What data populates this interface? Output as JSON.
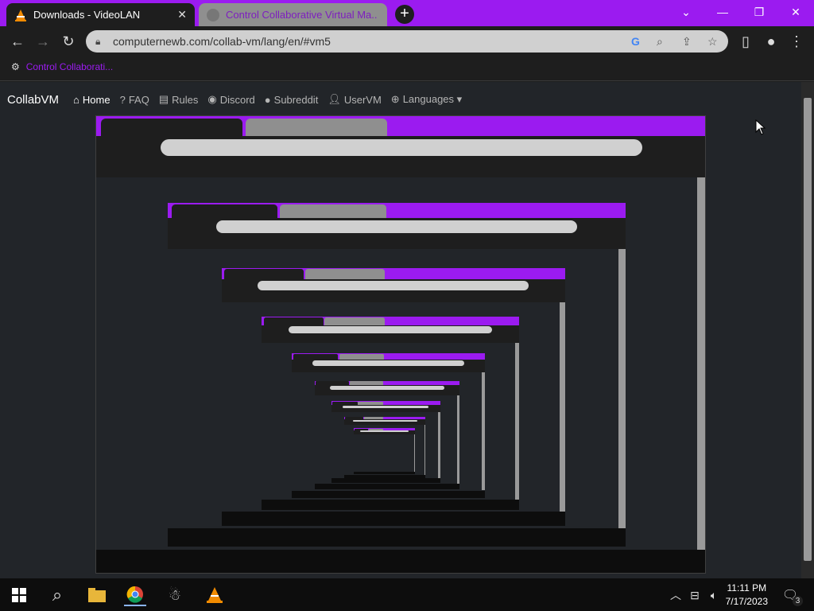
{
  "browser": {
    "tabs": [
      {
        "title": "Downloads - VideoLAN",
        "active": true
      },
      {
        "title": "Control Collaborative Virtual Ma...",
        "active": false
      }
    ],
    "url": "computernewb.com/collab-vm/lang/en/#vm5",
    "bookmark": "Control Collaborati..."
  },
  "site": {
    "brand": "CollabVM",
    "nav": [
      {
        "label": "Home",
        "icon": "home-icon",
        "active": true
      },
      {
        "label": "FAQ",
        "icon": "question-icon"
      },
      {
        "label": "Rules",
        "icon": "clipboard-icon"
      },
      {
        "label": "Discord",
        "icon": "discord-icon"
      },
      {
        "label": "Subreddit",
        "icon": "reddit-icon"
      },
      {
        "label": "UserVM",
        "icon": "user-icon"
      },
      {
        "label": "Languages ▾",
        "icon": "globe-icon"
      }
    ]
  },
  "taskbar": {
    "time": "11:11 PM",
    "date": "7/17/2023",
    "notifications": "3"
  },
  "colors": {
    "accent": "#9b1bf0",
    "dark": "#1e1e1e"
  }
}
